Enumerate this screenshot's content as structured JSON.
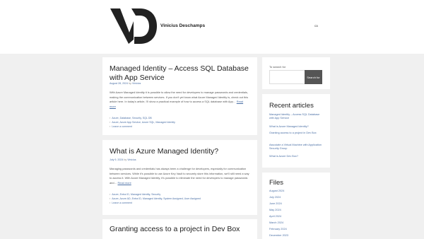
{
  "header": {
    "site_title": "Vinicius Deschamps",
    "lang": "ca"
  },
  "posts": [
    {
      "title": "Managed Identity – Access SQL Database with App Service",
      "date": "August 28, 2024",
      "author": "Vinicius",
      "excerpt": "With Azure Managed Identity it is possible to allow the need for developers to manage passwords and credentials, making the communication between services. If you don't yet know what Azure Managed Identity is, check out this article here. In today's article, I'll show a practical example of how to access a SQL database with App…",
      "read_more": "Read more",
      "categories": "Azure, Database, Security, SQL DB",
      "tags": "Azure, Azure App Service, Azure SQL, Managed Identity",
      "comments": "Leave a comment"
    },
    {
      "title": "What is Azure Managed Identity?",
      "date": "July 9, 2024",
      "author": "Vinicius",
      "excerpt": "Managing passwords and credentials has always been a challenge for developers, especially for communication between services. While it's possible to use Azure Key Vault to securely store this information, we'll still need a way to access it. With Azure Managed Identity, it's possible to eliminate the need for developers to manage passwords and…",
      "read_more": "Read more",
      "categories": "Azure, Entra ID, Managed Identity, Security",
      "tags": "Azure, Azure AD, Entra ID, Managed Identity, System Assigned, User Assigned",
      "comments": "Leave a comment"
    },
    {
      "title": "Granting access to a project in Dev Box"
    }
  ],
  "sidebar": {
    "search": {
      "label": "To search for",
      "button": "Search for"
    },
    "recent_title": "Recent articles",
    "recent": [
      "Managed Identity – Access SQL Database with App Service",
      "What is Azure Managed Identity?",
      "Granting access to a project in Dev Box",
      "Associate a Virtual Machine with Application Security Group",
      "What is Azure Dev Box?"
    ],
    "files_title": "Files",
    "files": [
      "August 2024",
      "July 2024",
      "June 2024",
      "May 2024",
      "April 2024",
      "March 2024",
      "February 2024",
      "December 2023"
    ]
  }
}
